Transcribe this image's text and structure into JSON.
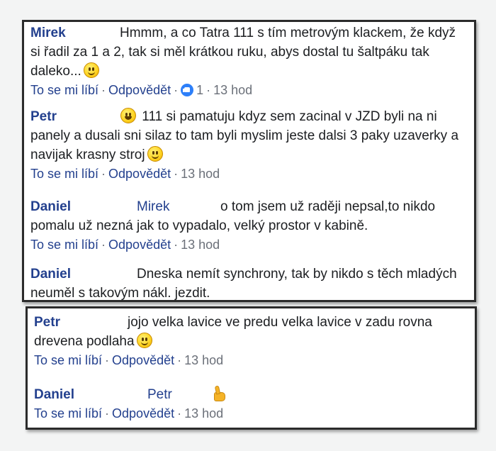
{
  "actions": {
    "like": "To se mi líbí",
    "reply": "Odpovědět",
    "separator": "·"
  },
  "comments": [
    {
      "author": "Mirek",
      "text": "Hmmm, a co Tatra 111 s tím metrovým klackem, že když si řadil za 1 a 2, tak si měl krátkou ruku, abys dostal tu šaltpáku tak daleko...",
      "like_count": "1",
      "time": "13 hod"
    },
    {
      "author": "Petr",
      "text": "111 si pamatuju kdyz sem zacinal v JZD byli na ni panely a dusali sni silaz to tam byli myslim jeste dalsi 3 paky uzaverky a navijak krasny stroj",
      "time": "13 hod"
    },
    {
      "author": "Daniel",
      "mention": "Mirek",
      "text": "o tom jsem už raději nepsal,to nikdo pomalu už nezná jak to vypadalo, velký prostor v kabině.",
      "time": "13 hod"
    },
    {
      "author": "Daniel",
      "text": "Dneska nemít synchrony, tak by nikdo s těch mladých neuměl s takovým nákl. jezdit."
    },
    {
      "author": "Petr",
      "text": "jojo velka lavice ve predu velka lavice v zadu rovna drevena podlaha",
      "time": "13 hod"
    },
    {
      "author": "Daniel",
      "mention": "Petr",
      "time": "13 hod"
    }
  ],
  "colors": {
    "link": "#23408e",
    "meta": "#6b7079",
    "like_badge": "#2d7ff9",
    "emoji": "#ffd524"
  },
  "icons": [
    "smile-emoji-icon",
    "grin-emoji-icon",
    "like-reaction-icon",
    "thumbs-up-emoji-icon"
  ]
}
